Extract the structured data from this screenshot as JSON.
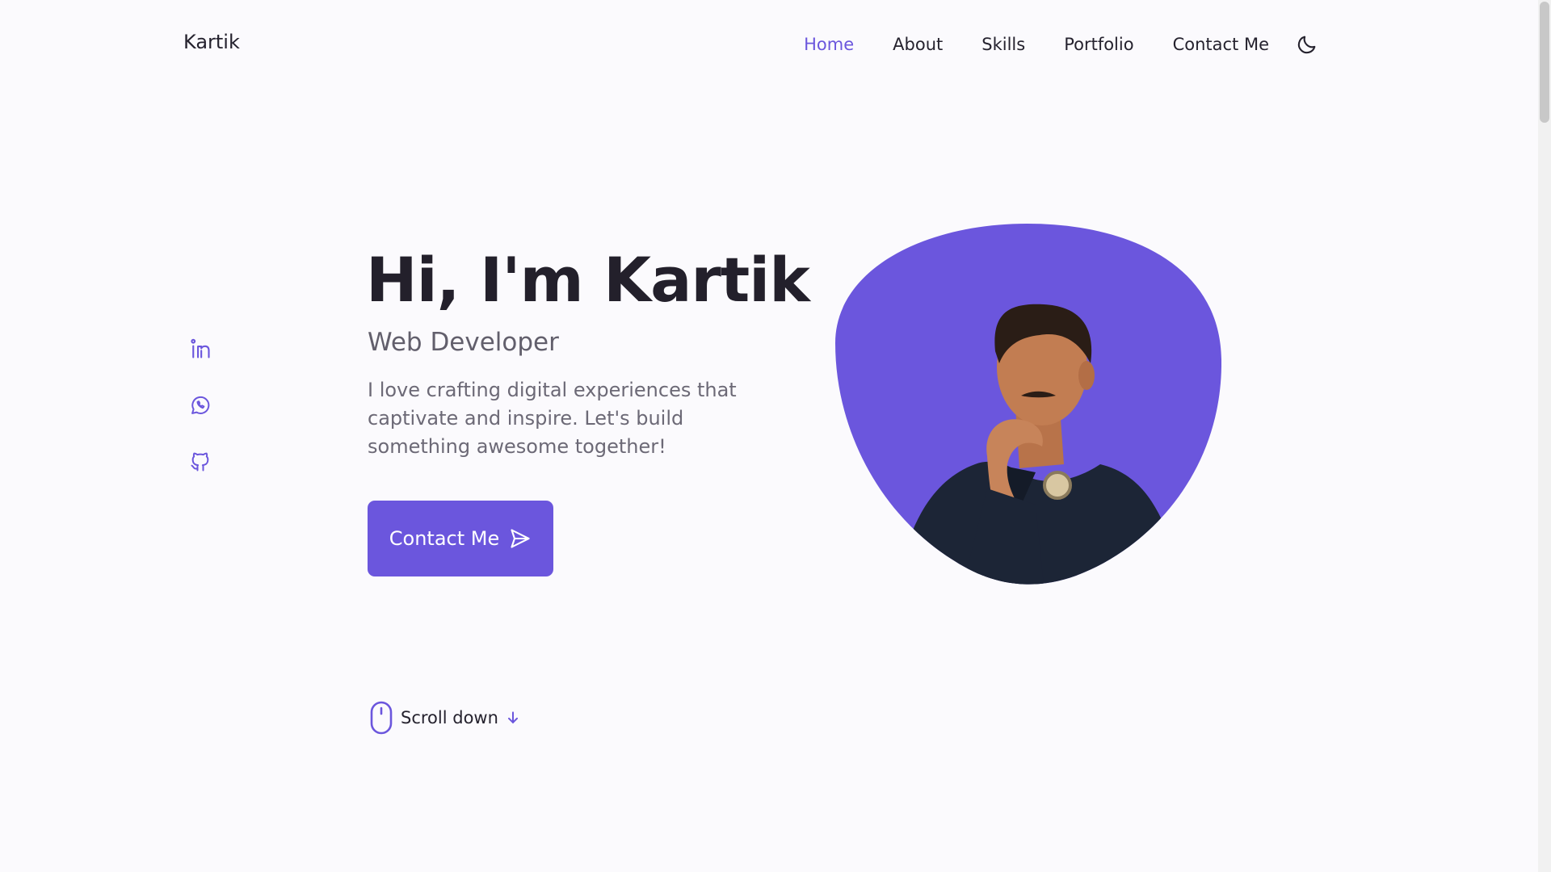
{
  "header": {
    "logo": "Kartik",
    "nav": [
      {
        "label": "Home",
        "active": true
      },
      {
        "label": "About",
        "active": false
      },
      {
        "label": "Skills",
        "active": false
      },
      {
        "label": "Portfolio",
        "active": false
      },
      {
        "label": "Contact Me",
        "active": false
      }
    ],
    "theme_toggle_icon": "moon-icon"
  },
  "social": [
    {
      "name": "linkedin",
      "icon": "linkedin-icon"
    },
    {
      "name": "whatsapp",
      "icon": "whatsapp-icon"
    },
    {
      "name": "github",
      "icon": "github-icon"
    }
  ],
  "hero": {
    "title": "Hi, I'm Kartik",
    "subtitle": "Web Developer",
    "description": "I love crafting digital experiences that captivate and inspire. Let's build something awesome together!",
    "cta_label": "Contact Me",
    "cta_icon": "send-icon"
  },
  "scroll": {
    "label": "Scroll down",
    "mouse_icon": "mouse-icon",
    "arrow_icon": "arrow-down-icon"
  },
  "colors": {
    "accent": "#6b56dd",
    "background": "#fbfafd",
    "text": "#25222e",
    "muted": "#6c6976"
  }
}
